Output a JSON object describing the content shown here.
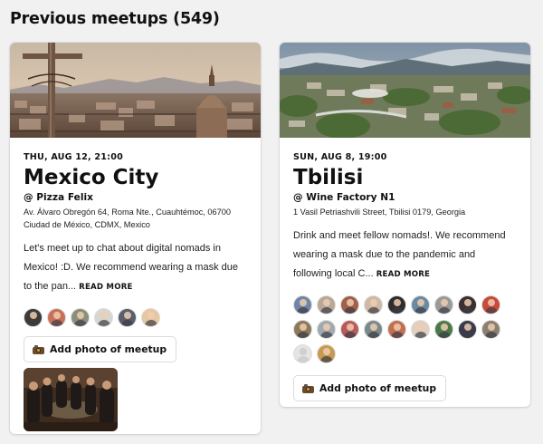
{
  "section": {
    "title": "Previous meetups (549)"
  },
  "meetups": [
    {
      "date": "THU, AUG 12, 21:00",
      "city": "Mexico City",
      "venue": "@ Pizza Felix",
      "address": "Av. Álvaro Obregón 64, Roma Nte., Cuauhtémoc, 06700 Ciudad de México, CDMX, Mexico",
      "description": "Let's meet up to chat about digital nomads in Mexico! :D. We recommend wearing a mask due to the pan...",
      "read_more": "READ MORE",
      "attendee_count": 6,
      "add_photo": "Add photo of meetup"
    },
    {
      "date": "SUN, AUG 8, 19:00",
      "city": "Tbilisi",
      "venue": "@ Wine Factory N1",
      "address": "1 Vasil Petriashvili Street, Tbilisi 0179, Georgia",
      "description": "Drink and meet fellow nomads!. We recommend wearing a mask due to the pandemic and following local C...",
      "read_more": "READ MORE",
      "attendee_count": 18,
      "add_photo": "Add photo of meetup"
    }
  ],
  "icons": {
    "camera": "camera-icon"
  },
  "colors": {
    "background": "#f1f1f1",
    "card": "#ffffff",
    "text": "#111111"
  }
}
